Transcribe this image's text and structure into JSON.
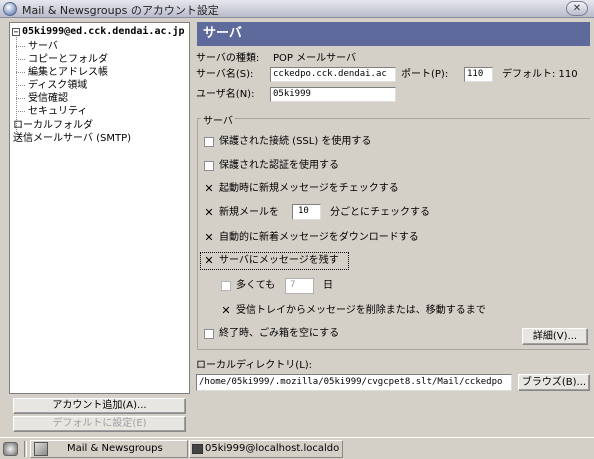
{
  "window": {
    "title": "Mail & Newsgroups のアカウント設定",
    "close_glyph": "✕"
  },
  "tree": {
    "account": "05ki999@ed.cck.dendai.ac.jp",
    "expander": "−",
    "children": [
      "サーバ",
      "コピーとフォルダ",
      "編集とアドレス帳",
      "ディスク領域",
      "受信確認",
      "セキュリティ"
    ],
    "local_folders": "ローカルフォルダ",
    "smtp": "送信メールサーバ (SMTP)"
  },
  "buttons": {
    "add_account": "アカウント追加(A)...",
    "set_default": "デフォルトに設定(E)",
    "details": "詳細(V)...",
    "browse": "ブラウズ(B)..."
  },
  "panel": {
    "header": "サーバ",
    "server_type_label": "サーバの種類:",
    "server_type_value": "POP メールサーバ",
    "server_name_label": "サーバ名(S):",
    "server_name_value": "cckedpo.cck.dendai.ac",
    "port_label": "ポート(P):",
    "port_value": "110",
    "default_port_label": "デフォルト: 110",
    "username_label": "ユーザ名(N):",
    "username_value": "05ki999"
  },
  "settings": {
    "group_title": "サーバ",
    "ssl": {
      "label": "保護された接続 (SSL) を使用する",
      "checked": false
    },
    "secure_auth": {
      "label": "保護された認証を使用する",
      "checked": false
    },
    "check_startup": {
      "label": "起動時に新規メッセージをチェックする",
      "checked": true
    },
    "check_every_prefix": "新規メールを",
    "check_every_value": "10",
    "check_every_suffix": "分ごとにチェックする",
    "check_every_checked": true,
    "auto_download": {
      "label": "自動的に新着メッセージをダウンロードする",
      "checked": true
    },
    "leave_on_server": {
      "label": "サーバにメッセージを残す",
      "checked": true
    },
    "at_most_label": "多くても",
    "at_most_value": "7",
    "at_most_unit": "日",
    "at_most_checked": false,
    "delete_on_move": {
      "label": "受信トレイからメッセージを削除または、移動するまで",
      "checked": true
    },
    "empty_trash": {
      "label": "終了時、ごみ箱を空にする",
      "checked": false
    },
    "check_glyph": "✕"
  },
  "local_dir": {
    "label": "ローカルディレクトリ(L):",
    "value": "/home/05ki999/.mozilla/05ki999/cvgcpet8.slt/Mail/cckedpo"
  },
  "taskbar": {
    "task1": "Mail & Newsgroups",
    "task2": "05ki999@localhost.localdo"
  }
}
